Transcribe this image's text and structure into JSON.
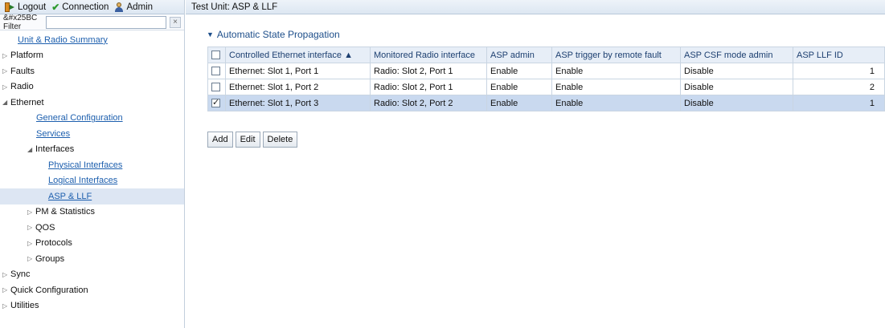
{
  "topbar": {
    "logout_label": "Logout",
    "connection_label": "Connection",
    "admin_label": "Admin"
  },
  "filter": {
    "label": "&#x25BC Filter",
    "value": "",
    "clear_symbol": "×"
  },
  "tree": [
    {
      "label": "Unit & Radio Summary"
    },
    {
      "label": "Platform"
    },
    {
      "label": "Faults"
    },
    {
      "label": "Radio"
    },
    {
      "label": "Ethernet"
    },
    {
      "label": "General Configuration"
    },
    {
      "label": "Services"
    },
    {
      "label": "Interfaces"
    },
    {
      "label": "Physical Interfaces"
    },
    {
      "label": "Logical Interfaces"
    },
    {
      "label": "ASP & LLF"
    },
    {
      "label": "PM & Statistics"
    },
    {
      "label": "QOS"
    },
    {
      "label": "Protocols"
    },
    {
      "label": "Groups"
    },
    {
      "label": "Sync"
    },
    {
      "label": "Quick Configuration"
    },
    {
      "label": "Utilities"
    }
  ],
  "main": {
    "title": "Test Unit: ASP & LLF",
    "section_title": "Automatic State Propagation"
  },
  "table": {
    "columns": [
      "Controlled Ethernet interface ▲",
      "Monitored Radio interface",
      "ASP admin",
      "ASP trigger by remote fault",
      "ASP CSF mode admin",
      "ASP LLF ID"
    ],
    "rows": [
      {
        "checked": false,
        "controlled": "Ethernet: Slot 1, Port 1",
        "monitored": "Radio: Slot 2, Port 1",
        "asp_admin": "Enable",
        "trigger": "Enable",
        "csf": "Disable",
        "llf_id": "1"
      },
      {
        "checked": false,
        "controlled": "Ethernet: Slot 1, Port 2",
        "monitored": "Radio: Slot 2, Port 1",
        "asp_admin": "Enable",
        "trigger": "Enable",
        "csf": "Disable",
        "llf_id": "2"
      },
      {
        "checked": true,
        "controlled": "Ethernet: Slot 1, Port 3",
        "monitored": "Radio: Slot 2, Port 2",
        "asp_admin": "Enable",
        "trigger": "Enable",
        "csf": "Disable",
        "llf_id": "1"
      }
    ]
  },
  "buttons": {
    "add": "Add",
    "edit": "Edit",
    "delete": "Delete"
  },
  "colors": {
    "link": "#1d5fae",
    "header_bg": "#e7eef7",
    "selected_row": "#c9d9ef",
    "selected_tree": "#dde6f3"
  }
}
